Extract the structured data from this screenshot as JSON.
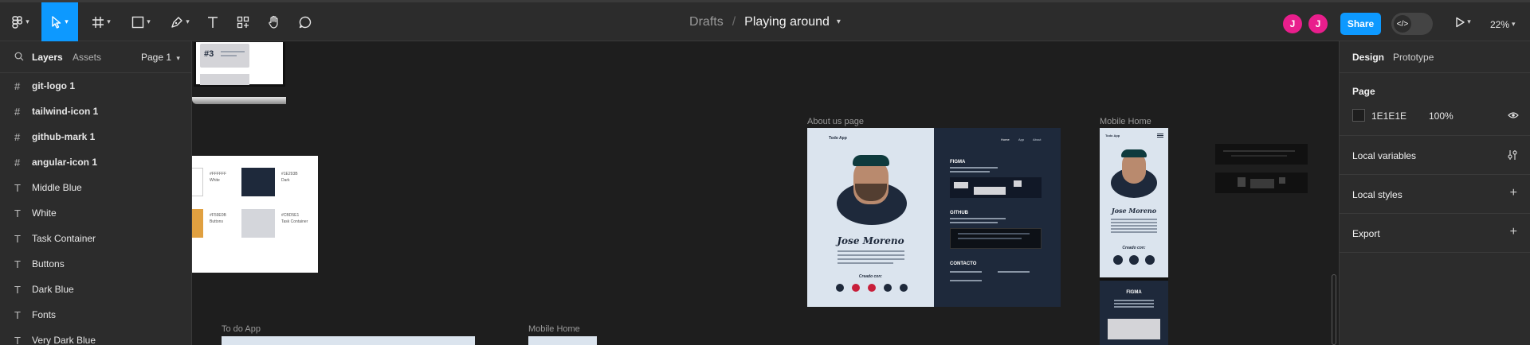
{
  "toolbar": {
    "zoom": "22%"
  },
  "breadcrumb": {
    "drafts": "Drafts",
    "separator": "/",
    "file": "Playing around"
  },
  "avatars": [
    "J",
    "J"
  ],
  "share_label": "Share",
  "left_panel": {
    "tabs": [
      "Layers",
      "Assets"
    ],
    "page_selector": "Page 1",
    "layers": [
      {
        "name": "git-logo 1",
        "icon": "frame-icon"
      },
      {
        "name": "tailwind-icon 1",
        "icon": "frame-icon"
      },
      {
        "name": "github-mark 1",
        "icon": "frame-icon"
      },
      {
        "name": "angular-icon 1",
        "icon": "frame-icon"
      },
      {
        "name": "Middle Blue",
        "icon": "text-icon"
      },
      {
        "name": "White",
        "icon": "text-icon"
      },
      {
        "name": "Task Container",
        "icon": "text-icon"
      },
      {
        "name": "Buttons",
        "icon": "text-icon"
      },
      {
        "name": "Dark Blue",
        "icon": "text-icon"
      },
      {
        "name": "Fonts",
        "icon": "text-icon"
      },
      {
        "name": "Very Dark Blue",
        "icon": "text-icon"
      }
    ]
  },
  "right_panel": {
    "tabs": [
      "Design",
      "Prototype"
    ],
    "page_heading": "Page",
    "page_color": "1E1E1E",
    "page_opacity": "100%",
    "sections": [
      "Local variables",
      "Local styles",
      "Export"
    ]
  },
  "canvas": {
    "about_label": "About us page",
    "mobile_home_label": "Mobile Home",
    "todo_label": "To do App",
    "mobile_home_label_2": "Mobile Home",
    "number_card": "#3",
    "about": {
      "app_name": "Todo App",
      "nav": [
        "Home",
        "App",
        "About"
      ],
      "person": "Jose Moreno",
      "created_with": "Creado con:",
      "sections": [
        "FIGMA",
        "GITHUB",
        "CONTACTO"
      ]
    },
    "mobile": {
      "app_name": "Todo App",
      "person": "Jose Moreno",
      "created_with": "Creado con:",
      "figma": "FIGMA"
    },
    "swatches": [
      {
        "hex": "#FFFFFF",
        "name": "White"
      },
      {
        "hex": "#1E293B",
        "name": "Dark"
      },
      {
        "hex": "#F59E0B",
        "name": "Buttons"
      },
      {
        "hex": "#CBD5E1",
        "name": "Task Container"
      }
    ]
  },
  "colors": {
    "accent": "#0d99ff",
    "avatar": "#e91e8c",
    "canvas": "#1e1e1e",
    "panel": "#2c2c2c"
  }
}
